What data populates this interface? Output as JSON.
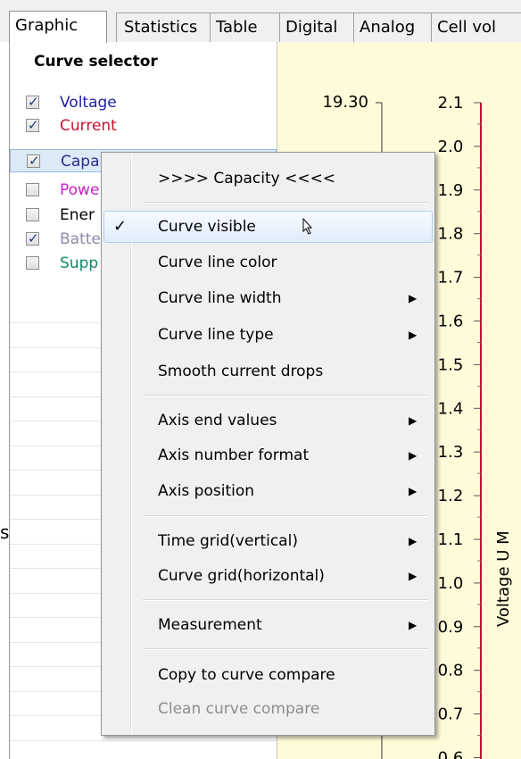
{
  "tabs": [
    "Graphic",
    "Statistics",
    "Table",
    "Digital",
    "Analog",
    "Cell vol"
  ],
  "curve_selector": {
    "header": "Curve selector",
    "items": [
      {
        "label": "Voltage",
        "checked": true,
        "color": "#1f1fa0"
      },
      {
        "label": "Current",
        "checked": true,
        "color": "#c8102e"
      },
      {
        "label": "Capa",
        "checked": true,
        "color": "#2b2b8f"
      },
      {
        "label": "Powe",
        "checked": false,
        "color": "#c71fc7"
      },
      {
        "label": "Ener",
        "checked": false,
        "color": "#000000"
      },
      {
        "label": "Batte",
        "checked": true,
        "color": "#8a8aa8"
      },
      {
        "label": "Supp",
        "checked": false,
        "color": "#108a6a"
      }
    ]
  },
  "plot": {
    "top_value": "19.30",
    "axis_ticks": [
      "2.1",
      "2.0",
      "1.9",
      "1.8",
      "1.7",
      "1.6",
      "1.5",
      "1.4",
      "1.3",
      "1.2",
      "1.1",
      "1.0",
      "0.9",
      "0.8",
      "0.7",
      "0.6"
    ],
    "axis_label": "Voltage U M"
  },
  "left_edge_char": "s",
  "context_menu": {
    "title": ">>>>  Capacity  <<<<",
    "items": {
      "curve_visible": "Curve visible",
      "curve_line_color": "Curve line color",
      "curve_line_width": "Curve line width",
      "curve_line_type": "Curve line type",
      "smooth_current_drops": "Smooth current drops",
      "axis_end_values": "Axis end values",
      "axis_number_format": "Axis number format",
      "axis_position": "Axis position",
      "time_grid": "Time grid(vertical)",
      "curve_grid": "Curve grid(horizontal)",
      "measurement": "Measurement",
      "copy_to_compare": "Copy to curve compare",
      "clean_compare": "Clean curve compare"
    },
    "check_glyph": "✓",
    "submenu_glyph": "▶"
  }
}
